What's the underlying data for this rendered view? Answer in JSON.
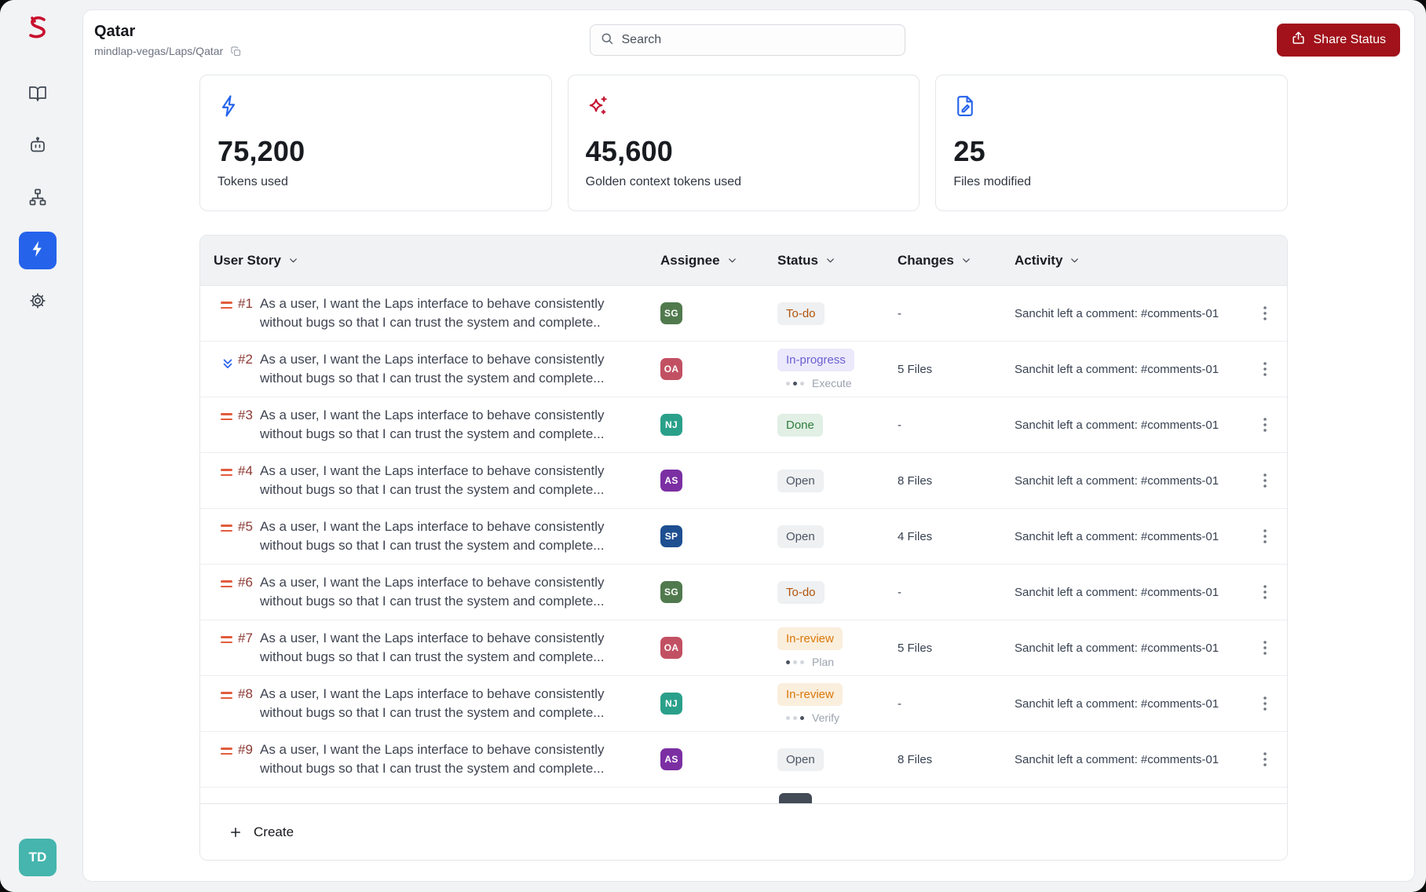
{
  "colors": {
    "brand_red": "#c8102e",
    "share_button_bg": "#a1121b",
    "nav_active_bg": "#2563eb",
    "user_avatar_bg": "#45b5ad",
    "handle_orange": "#e25c3d"
  },
  "sidebar": {
    "items": [
      {
        "icon": "book-icon",
        "active": false
      },
      {
        "icon": "bot-icon",
        "active": false
      },
      {
        "icon": "sitemap-icon",
        "active": false
      },
      {
        "icon": "lightning-icon",
        "active": true
      },
      {
        "icon": "gear-icon",
        "active": false
      }
    ],
    "avatar_initials": "TD"
  },
  "header": {
    "title": "Qatar",
    "breadcrumb": "mindlap-vegas/Laps/Qatar",
    "search_placeholder": "Search",
    "share_label": "Share Status"
  },
  "stats": [
    {
      "icon": "lightning-icon",
      "icon_color": "#2563eb",
      "value": "75,200",
      "label": "Tokens used"
    },
    {
      "icon": "sparkles-icon",
      "icon_color": "#c41230",
      "value": "45,600",
      "label": "Golden context tokens used"
    },
    {
      "icon": "file-edit-icon",
      "icon_color": "#2563eb",
      "value": "25",
      "label": "Files modified"
    }
  ],
  "table": {
    "columns": [
      "User Story",
      "Assignee",
      "Status",
      "Changes",
      "Activity"
    ],
    "status_styles": {
      "todo": {
        "bg": "#eef0f2",
        "fg": "#b45309"
      },
      "in-progress": {
        "bg": "#ebe9fb",
        "fg": "#6d5ed2"
      },
      "done": {
        "bg": "#e1efe5",
        "fg": "#2f7d3b"
      },
      "open": {
        "bg": "#eef0f2",
        "fg": "#4b5563"
      },
      "in-review": {
        "bg": "#faeedd",
        "fg": "#d97706"
      }
    },
    "rows": [
      {
        "id": "#1",
        "title_l1": "As a user, I want the Laps interface to behave consistently",
        "title_l2": "without bugs so that I can trust the system and complete..",
        "assignee": "SG",
        "assignee_color": "#507a4e",
        "status": "To-do",
        "status_type": "todo",
        "changes": "-",
        "activity": "Sanchit left a comment: #comments-01",
        "handle": "drag"
      },
      {
        "id": "#2",
        "title_l1": "As a user, I want the Laps interface to behave consistently",
        "title_l2": "without bugs so that I can trust the system and complete...",
        "assignee": "OA",
        "assignee_color": "#c25063",
        "status": "In-progress",
        "status_type": "in-progress",
        "stage": "Execute",
        "stage_index": 1,
        "changes": "5 Files",
        "activity": "Sanchit left a comment: #comments-01",
        "handle": "chevrons"
      },
      {
        "id": "#3",
        "title_l1": "As a user, I want the Laps interface to behave consistently",
        "title_l2": "without bugs so that I can trust the system and complete...",
        "assignee": "NJ",
        "assignee_color": "#2aa08a",
        "status": "Done",
        "status_type": "done",
        "changes": "-",
        "activity": "Sanchit left a comment: #comments-01",
        "handle": "drag"
      },
      {
        "id": "#4",
        "title_l1": "As a user, I want the Laps interface to behave consistently",
        "title_l2": "without bugs so that I can trust the system and complete...",
        "assignee": "AS",
        "assignee_color": "#7b2fa3",
        "status": "Open",
        "status_type": "open",
        "changes": "8 Files",
        "activity": "Sanchit left a comment: #comments-01",
        "handle": "drag"
      },
      {
        "id": "#5",
        "title_l1": "As a user, I want the Laps interface to behave consistently",
        "title_l2": "without bugs so that I can trust the system and complete...",
        "assignee": "SP",
        "assignee_color": "#1d4f91",
        "status": "Open",
        "status_type": "open",
        "changes": "4 Files",
        "activity": "Sanchit left a comment: #comments-01",
        "handle": "drag"
      },
      {
        "id": "#6",
        "title_l1": "As a user, I want the Laps interface to behave consistently",
        "title_l2": "without bugs so that I can trust the system and complete...",
        "assignee": "SG",
        "assignee_color": "#507a4e",
        "status": "To-do",
        "status_type": "todo",
        "changes": "-",
        "activity": "Sanchit left a comment: #comments-01",
        "handle": "drag"
      },
      {
        "id": "#7",
        "title_l1": "As a user, I want the Laps interface to behave consistently",
        "title_l2": "without bugs so that I can trust the system and complete...",
        "assignee": "OA",
        "assignee_color": "#c25063",
        "status": "In-review",
        "status_type": "in-review",
        "stage": "Plan",
        "stage_index": 0,
        "changes": "5 Files",
        "activity": "Sanchit left a comment: #comments-01",
        "handle": "drag"
      },
      {
        "id": "#8",
        "title_l1": "As a user, I want the Laps interface to behave consistently",
        "title_l2": "without bugs so that I can trust the system and complete...",
        "assignee": "NJ",
        "assignee_color": "#2aa08a",
        "status": "In-review",
        "status_type": "in-review",
        "stage": "Verify",
        "stage_index": 2,
        "changes": "-",
        "activity": "Sanchit left a comment: #comments-01",
        "handle": "drag"
      },
      {
        "id": "#9",
        "title_l1": "As a user, I want the Laps interface to behave consistently",
        "title_l2": "without bugs so that I can trust the system and complete...",
        "assignee": "AS",
        "assignee_color": "#7b2fa3",
        "status": "Open",
        "status_type": "open",
        "changes": "8 Files",
        "activity": "Sanchit left a comment: #comments-01",
        "handle": "drag"
      }
    ],
    "create_label": "Create"
  }
}
